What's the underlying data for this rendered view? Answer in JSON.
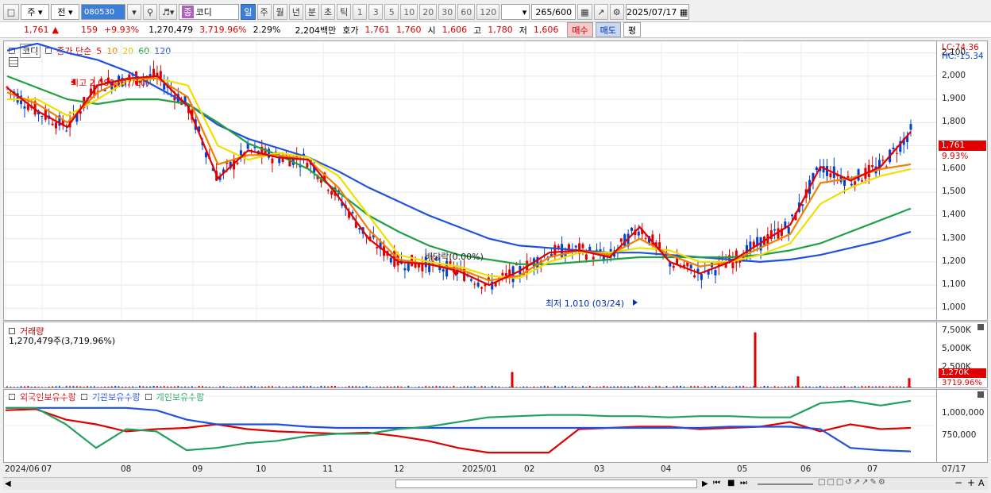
{
  "toolbar": {
    "market_label": "주",
    "whole_label": "전",
    "code": "080530",
    "name_badge": "종",
    "name": "코디",
    "periods": [
      "일",
      "주",
      "월",
      "년",
      "분",
      "초",
      "틱"
    ],
    "period_values": [
      "1",
      "3",
      "5",
      "10",
      "20",
      "30",
      "60",
      "120"
    ],
    "count": "265",
    "count_total": "/600",
    "date": "2025/07/17"
  },
  "quote": {
    "price": "1,761",
    "change_arrow": "▲",
    "change": "159",
    "change_pct": "+9.93%",
    "volume": "1,270,479",
    "volume_pct": "3,719.96%",
    "turnover": "2.29%",
    "amount": "2,204백만",
    "bid_label": "호가",
    "bid1": "1,761",
    "bid2": "1,760",
    "open_label": "시",
    "open": "1,606",
    "high_label": "고",
    "high": "1,780",
    "low_label": "저",
    "low": "1,606",
    "buy_label": "매수",
    "sell_label": "매도",
    "eval_label": "평"
  },
  "price_pane": {
    "name": "코디",
    "ma_title": "종가 단순",
    "ma_periods": [
      "5",
      "10",
      "20",
      "60",
      "120"
    ],
    "ma_colors": [
      "#e00000",
      "#f08000",
      "#f0e000",
      "#20a040",
      "#2050e0"
    ],
    "max_label": "최고 2,080 (07/10)",
    "min_label": "최저 1,010 (03/24)",
    "dividend_label": "배당락(0.00%)",
    "lc_label": "LC:74.36",
    "hc_label": "HC:-15.34",
    "current_tag": "1,761",
    "current_pct": "9.93%",
    "y_ticks": [
      "2,100",
      "2,000",
      "1,900",
      "1,800",
      "1,700",
      "1,600",
      "1,500",
      "1,400",
      "1,300",
      "1,200",
      "1,100",
      "1,000"
    ]
  },
  "volume_pane": {
    "title": "거래량",
    "value": "1,270,479주(3,719.96%)",
    "y_ticks": [
      "7,500K",
      "5,000K",
      "2,500K"
    ],
    "current_tag": "1,270K",
    "current_pct": "3719.96%"
  },
  "holding_pane": {
    "series": [
      "외국인보유수량",
      "기관보유수량",
      "개인보유수량"
    ],
    "colors": [
      "#e00000",
      "#2050e0",
      "#20a060"
    ],
    "y_ticks": [
      "1,000,000",
      "750,000"
    ]
  },
  "x_axis": {
    "labels": [
      "2024/06",
      "07",
      "08",
      "09",
      "10",
      "11",
      "12",
      "2025/01",
      "02",
      "03",
      "04",
      "05",
      "06",
      "07"
    ],
    "right_label": "07/17"
  },
  "chart_data": {
    "type": "candlestick",
    "x_start": "2024/06",
    "x_end": "2025/07/17",
    "ylim": [
      950,
      2150
    ],
    "price_high": 2080,
    "price_high_date": "07/10",
    "price_low": 1010,
    "price_low_date": "03/24",
    "last_close": 1761,
    "ma_series": [
      {
        "name": "5",
        "color": "#e00000",
        "values": [
          1950,
          1850,
          1780,
          1960,
          1990,
          2000,
          1870,
          1560,
          1680,
          1650,
          1640,
          1480,
          1300,
          1200,
          1190,
          1160,
          1100,
          1160,
          1240,
          1250,
          1220,
          1350,
          1200,
          1150,
          1200,
          1280,
          1360,
          1610,
          1550,
          1610,
          1761
        ]
      },
      {
        "name": "10",
        "color": "#f08000",
        "values": [
          1930,
          1880,
          1800,
          1930,
          1990,
          1990,
          1910,
          1620,
          1660,
          1660,
          1640,
          1520,
          1340,
          1210,
          1190,
          1170,
          1120,
          1140,
          1220,
          1250,
          1230,
          1300,
          1230,
          1180,
          1200,
          1260,
          1320,
          1540,
          1560,
          1600,
          1620
        ]
      },
      {
        "name": "20",
        "color": "#f0e000",
        "values": [
          1900,
          1900,
          1830,
          1900,
          1980,
          1990,
          1960,
          1700,
          1640,
          1670,
          1650,
          1570,
          1400,
          1230,
          1200,
          1180,
          1140,
          1130,
          1200,
          1240,
          1240,
          1260,
          1250,
          1200,
          1200,
          1230,
          1280,
          1450,
          1520,
          1570,
          1600
        ]
      },
      {
        "name": "60",
        "color": "#20a040",
        "values": [
          2000,
          1950,
          1900,
          1880,
          1900,
          1900,
          1880,
          1800,
          1710,
          1660,
          1600,
          1500,
          1400,
          1330,
          1270,
          1230,
          1210,
          1190,
          1190,
          1200,
          1210,
          1220,
          1220,
          1220,
          1220,
          1230,
          1250,
          1280,
          1330,
          1380,
          1430
        ]
      },
      {
        "name": "120",
        "color": "#2050e0",
        "values": [
          2110,
          2140,
          2100,
          2070,
          2020,
          1950,
          1880,
          1790,
          1730,
          1690,
          1650,
          1590,
          1520,
          1460,
          1400,
          1350,
          1300,
          1270,
          1260,
          1250,
          1240,
          1240,
          1230,
          1220,
          1210,
          1200,
          1210,
          1230,
          1260,
          1290,
          1330
        ]
      }
    ],
    "holding_series": [
      {
        "name": "외국인보유수량",
        "values": [
          880000,
          890000,
          800000,
          760000,
          700000,
          720000,
          730000,
          760000,
          720000,
          700000,
          690000,
          680000,
          690000,
          660000,
          620000,
          560000,
          520000,
          520000,
          520000,
          720000,
          730000,
          740000,
          740000,
          720000,
          730000,
          740000,
          780000,
          700000,
          760000,
          720000,
          730000
        ]
      },
      {
        "name": "기관보유수량",
        "values": [
          900000,
          900000,
          900000,
          900000,
          900000,
          880000,
          800000,
          760000,
          760000,
          760000,
          740000,
          730000,
          730000,
          730000,
          730000,
          730000,
          730000,
          730000,
          730000,
          730000,
          730000,
          730000,
          730000,
          730000,
          740000,
          740000,
          740000,
          720000,
          560000,
          540000,
          530000
        ]
      },
      {
        "name": "개인보유수량",
        "values": [
          900000,
          900000,
          760000,
          560000,
          720000,
          700000,
          540000,
          560000,
          600000,
          620000,
          660000,
          680000,
          680000,
          720000,
          740000,
          780000,
          820000,
          830000,
          840000,
          840000,
          830000,
          830000,
          820000,
          830000,
          830000,
          820000,
          820000,
          940000,
          960000,
          920000,
          960000
        ]
      }
    ],
    "volume_spikes": [
      {
        "date": "2025/01",
        "value": 2100000
      },
      {
        "date": "2025/05",
        "value": 7500000
      },
      {
        "date": "2025/06",
        "value": 1500000
      },
      {
        "date": "2025/07/17",
        "value": 1270479
      }
    ]
  }
}
